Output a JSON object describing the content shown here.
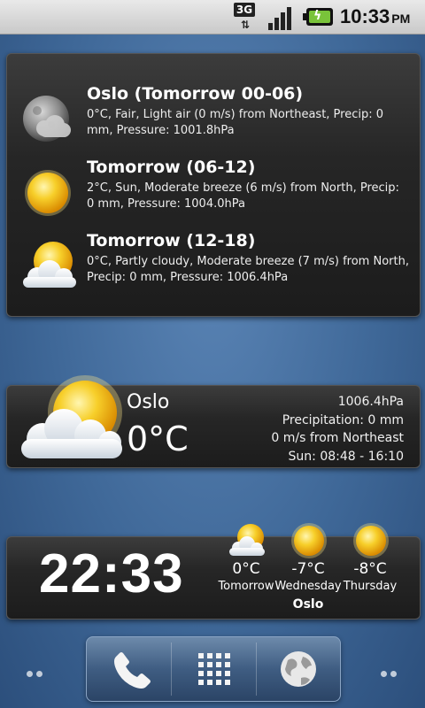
{
  "status_bar": {
    "network_label": "3G",
    "network_icon": "3g-data-icon",
    "signal_icon": "signal-strength-icon",
    "battery_icon": "battery-charging-icon",
    "time": "10:33",
    "ampm": "PM"
  },
  "forecast_widget": {
    "rows": [
      {
        "icon": "moon-cloud-icon",
        "title": "Oslo (Tomorrow 00-06)",
        "description": "0°C, Fair, Light air (0 m/s) from Northeast, Precip: 0 mm, Pressure: 1001.8hPa"
      },
      {
        "icon": "sun-icon",
        "title": "Tomorrow (06-12)",
        "description": "2°C, Sun, Moderate breeze (6 m/s) from North, Precip: 0 mm, Pressure: 1004.0hPa"
      },
      {
        "icon": "partly-cloudy-icon",
        "title": "Tomorrow (12-18)",
        "description": "0°C, Partly cloudy, Moderate breeze (7 m/s) from North, Precip: 0 mm, Pressure: 1006.4hPa"
      }
    ]
  },
  "current_widget": {
    "icon": "partly-cloudy-icon",
    "city": "Oslo",
    "temperature": "0°C",
    "pressure": "1006.4hPa",
    "precipitation": "Precipitation: 0 mm",
    "wind": "0 m/s from Northeast",
    "sun": "Sun: 08:48 - 16:10"
  },
  "clock_widget": {
    "time": "22:33",
    "city": "Oslo",
    "days": [
      {
        "icon": "partly-cloudy-icon",
        "temp": "0°C",
        "day": "Tomorrow"
      },
      {
        "icon": "sun-icon",
        "temp": "-7°C",
        "day": "Wednesday"
      },
      {
        "icon": "sun-icon",
        "temp": "-8°C",
        "day": "Thursday"
      }
    ]
  },
  "dock": {
    "items": [
      {
        "icon": "phone-icon"
      },
      {
        "icon": "app-grid-icon"
      },
      {
        "icon": "browser-globe-icon"
      }
    ]
  },
  "colors": {
    "wallpaper": "#3f6898",
    "panel": "#262626",
    "sun": "#f5c21b",
    "battery": "#79c33a"
  }
}
